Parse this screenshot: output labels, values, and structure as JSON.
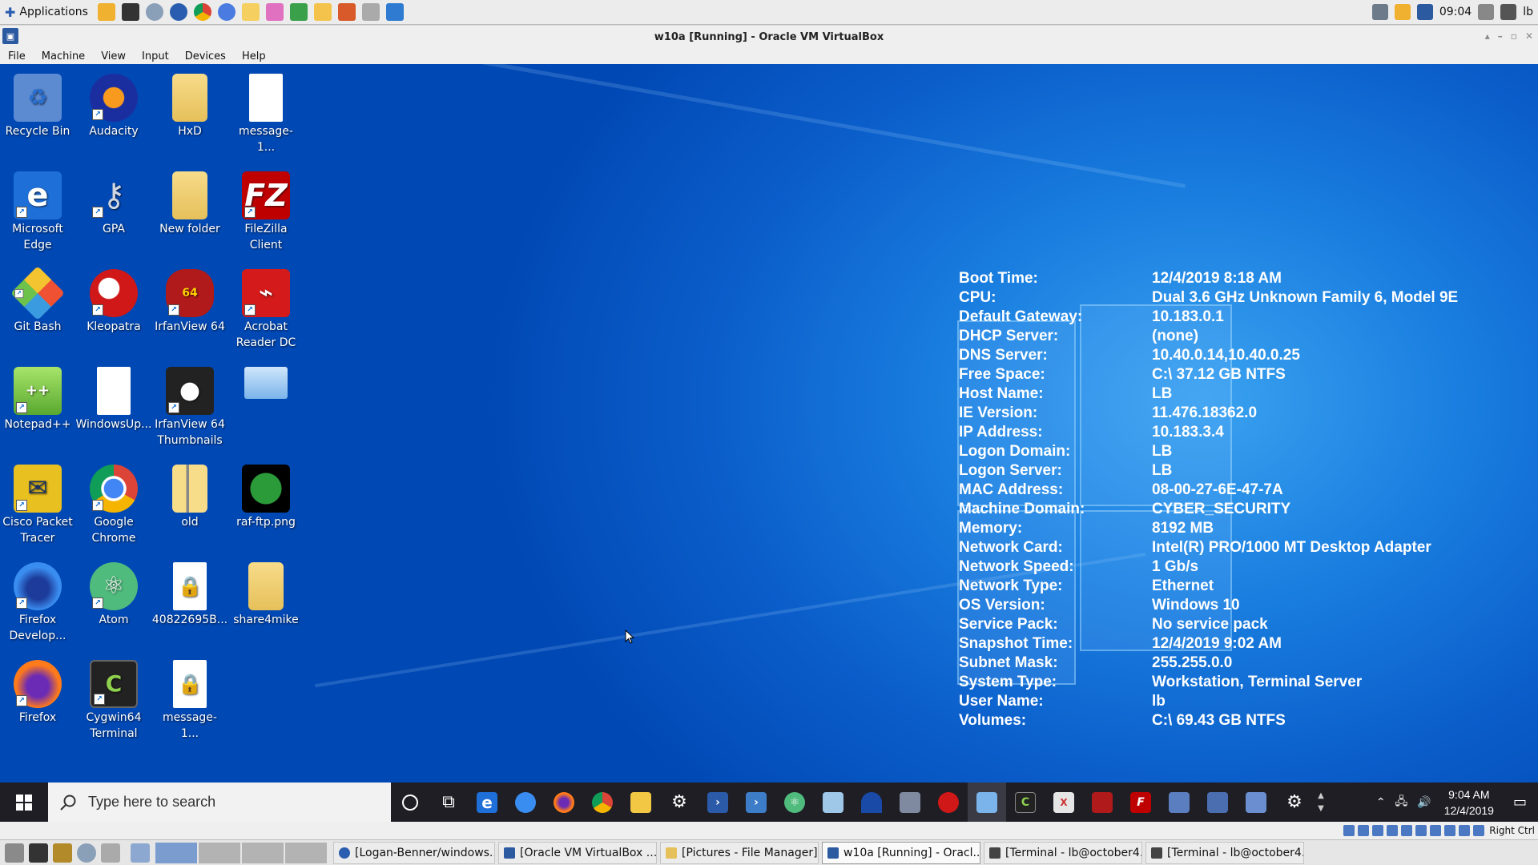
{
  "host_top": {
    "apps_label": "Applications",
    "clock": "09:04",
    "user": "lb"
  },
  "vbox": {
    "title": "w10a [Running] - Oracle VM VirtualBox",
    "menu": [
      "File",
      "Machine",
      "View",
      "Input",
      "Devices",
      "Help"
    ],
    "host_key": "Right Ctrl"
  },
  "desktop_icons": [
    {
      "label": "Recycle Bin",
      "icon": "recycle-bin-icon"
    },
    {
      "label": "Audacity",
      "icon": "audacity-icon"
    },
    {
      "label": "HxD",
      "icon": "folder-icon"
    },
    {
      "label": "message-1...",
      "icon": "document-icon"
    },
    {
      "label": "Microsoft Edge",
      "icon": "edge-icon"
    },
    {
      "label": "GPA",
      "icon": "gpa-icon"
    },
    {
      "label": "New folder",
      "icon": "folder-icon"
    },
    {
      "label": "FileZilla Client",
      "icon": "filezilla-icon"
    },
    {
      "label": "Git Bash",
      "icon": "git-bash-icon"
    },
    {
      "label": "Kleopatra",
      "icon": "kleopatra-icon"
    },
    {
      "label": "IrfanView 64",
      "icon": "irfanview-icon"
    },
    {
      "label": "Acrobat Reader DC",
      "icon": "acrobat-icon"
    },
    {
      "label": "Notepad++",
      "icon": "notepadpp-icon"
    },
    {
      "label": "WindowsUp...",
      "icon": "document-icon"
    },
    {
      "label": "IrfanView 64 Thumbnails",
      "icon": "irfanview-thumbnails-icon"
    },
    {
      "label": "",
      "icon": "control-panel-icon"
    },
    {
      "label": "Cisco Packet Tracer",
      "icon": "packet-tracer-icon"
    },
    {
      "label": "Google Chrome",
      "icon": "chrome-icon"
    },
    {
      "label": "old",
      "icon": "zip-folder-icon"
    },
    {
      "label": "raf-ftp.png",
      "icon": "image-file-icon"
    },
    {
      "label": "Firefox Develop...",
      "icon": "firefox-dev-icon"
    },
    {
      "label": "Atom",
      "icon": "atom-icon"
    },
    {
      "label": "40822695B...",
      "icon": "locked-file-icon"
    },
    {
      "label": "share4mike",
      "icon": "folder-icon"
    },
    {
      "label": "Firefox",
      "icon": "firefox-icon"
    },
    {
      "label": "Cygwin64 Terminal",
      "icon": "cygwin-icon"
    },
    {
      "label": "message-1...",
      "icon": "locked-file-icon"
    }
  ],
  "bginfo": [
    {
      "k": "Boot Time:",
      "v": "12/4/2019 8:18 AM"
    },
    {
      "k": "CPU:",
      "v": "Dual 3.6 GHz Unknown Family 6, Model 9E"
    },
    {
      "k": "Default Gateway:",
      "v": "10.183.0.1"
    },
    {
      "k": "DHCP Server:",
      "v": "(none)"
    },
    {
      "k": "DNS Server:",
      "v": "10.40.0.14,10.40.0.25"
    },
    {
      "k": "Free Space:",
      "v": "C:\\ 37.12 GB NTFS"
    },
    {
      "k": "Host Name:",
      "v": "LB"
    },
    {
      "k": "IE Version:",
      "v": "11.476.18362.0"
    },
    {
      "k": "IP Address:",
      "v": "10.183.3.4"
    },
    {
      "k": "Logon Domain:",
      "v": "LB"
    },
    {
      "k": "Logon Server:",
      "v": "LB"
    },
    {
      "k": "MAC Address:",
      "v": "08-00-27-6E-47-7A"
    },
    {
      "k": "Machine Domain:",
      "v": "CYBER_SECURITY"
    },
    {
      "k": "Memory:",
      "v": "8192 MB"
    },
    {
      "k": "Network Card:",
      "v": "Intel(R) PRO/1000 MT Desktop Adapter"
    },
    {
      "k": "Network Speed:",
      "v": "1 Gb/s"
    },
    {
      "k": "Network Type:",
      "v": "Ethernet"
    },
    {
      "k": "OS Version:",
      "v": "Windows 10"
    },
    {
      "k": "Service Pack:",
      "v": "No service pack"
    },
    {
      "k": "Snapshot Time:",
      "v": "12/4/2019 9:02 AM"
    },
    {
      "k": "Subnet Mask:",
      "v": "255.255.0.0"
    },
    {
      "k": "System Type:",
      "v": "Workstation, Terminal Server"
    },
    {
      "k": "User Name:",
      "v": "lb"
    },
    {
      "k": "Volumes:",
      "v": "C:\\ 69.43 GB NTFS"
    }
  ],
  "taskbar": {
    "search_placeholder": "Type here to search",
    "time": "9:04 AM",
    "date": "12/4/2019"
  },
  "host_tasks": [
    {
      "label": "[Logan-Benner/windows...",
      "active": false
    },
    {
      "label": "[Oracle VM VirtualBox ...",
      "active": false
    },
    {
      "label": "[Pictures - File Manager]",
      "active": false
    },
    {
      "label": "w10a [Running] - Oracl...",
      "active": true
    },
    {
      "label": "[Terminal - lb@october4...",
      "active": false
    },
    {
      "label": "[Terminal - lb@october4...",
      "active": false
    }
  ],
  "colors": {
    "desktop_blue": "#0a5cc9",
    "taskbar": "#1e1e24"
  }
}
